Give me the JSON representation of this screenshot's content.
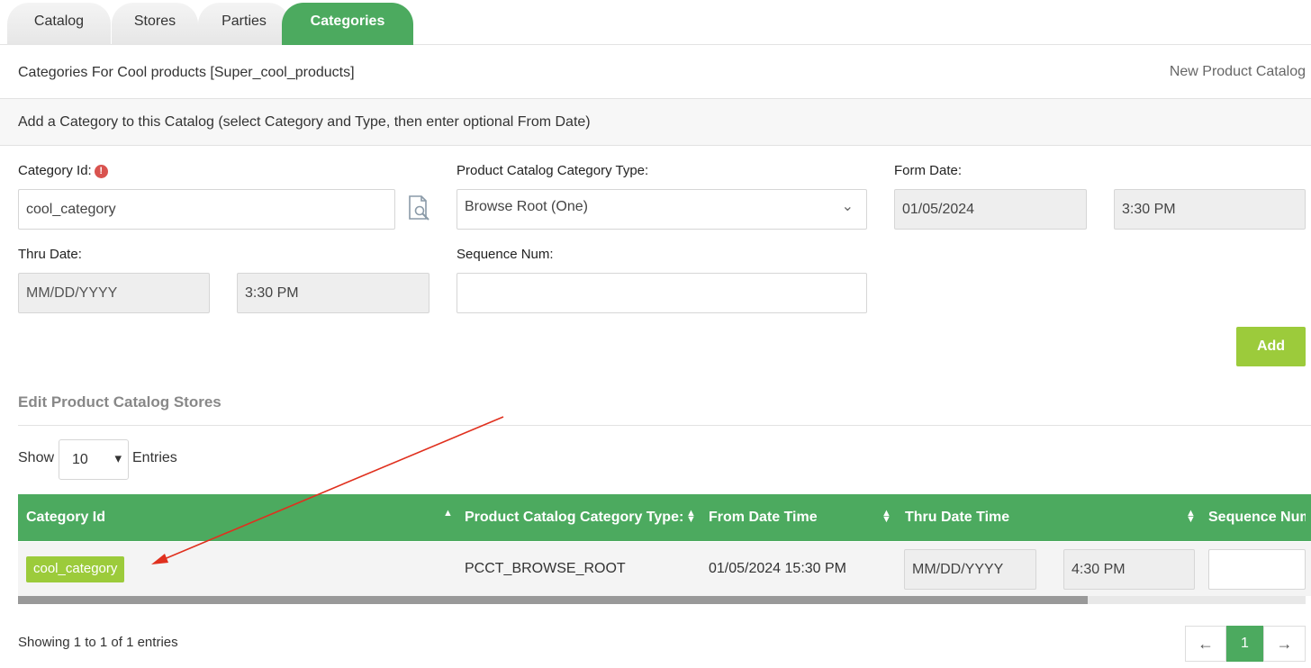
{
  "tabs": [
    {
      "label": "Catalog",
      "active": false
    },
    {
      "label": "Stores",
      "active": false
    },
    {
      "label": "Parties",
      "active": false
    },
    {
      "label": "Categories",
      "active": true
    }
  ],
  "header": {
    "title": "Categories For Cool products [Super_cool_products]",
    "new_link": "New Product Catalog"
  },
  "add_section": {
    "title": "Add a Category to this Catalog (select Category and Type, then enter optional From Date)"
  },
  "form": {
    "category_id_label": "Category Id:",
    "category_id_value": "cool_category",
    "type_label": "Product Catalog Category Type:",
    "type_value": "Browse Root (One)",
    "from_date_label": "Form Date:",
    "from_date_value": "01/05/2024",
    "from_time_value": "3:30 PM",
    "thru_date_label": "Thru Date:",
    "thru_date_value": "MM/DD/YYYY",
    "thru_time_value": "3:30 PM",
    "sequence_label": "Sequence Num:",
    "sequence_value": "",
    "add_button": "Add"
  },
  "stores_section": {
    "title": "Edit Product Catalog Stores",
    "show_label": "Show",
    "entries_value": "10",
    "entries_label": "Entries"
  },
  "table": {
    "columns": [
      "Category Id",
      "Product Catalog Category Type:",
      "From Date Time",
      "Thru Date Time",
      "Sequence Num"
    ],
    "rows": [
      {
        "category_id": "cool_category",
        "type": "PCCT_BROWSE_ROOT",
        "from_date_time": "01/05/2024 15:30 PM",
        "thru_date": "MM/DD/YYYY",
        "thru_time": "4:30 PM",
        "sequence": ""
      }
    ]
  },
  "footer": {
    "info": "Showing 1 to 1 of 1 entries",
    "prev": "←",
    "page": "1",
    "next": "→"
  },
  "colors": {
    "primary_green": "#4caa5f",
    "accent_lime": "#9ccb3b",
    "annotation_red": "#e0301e"
  }
}
